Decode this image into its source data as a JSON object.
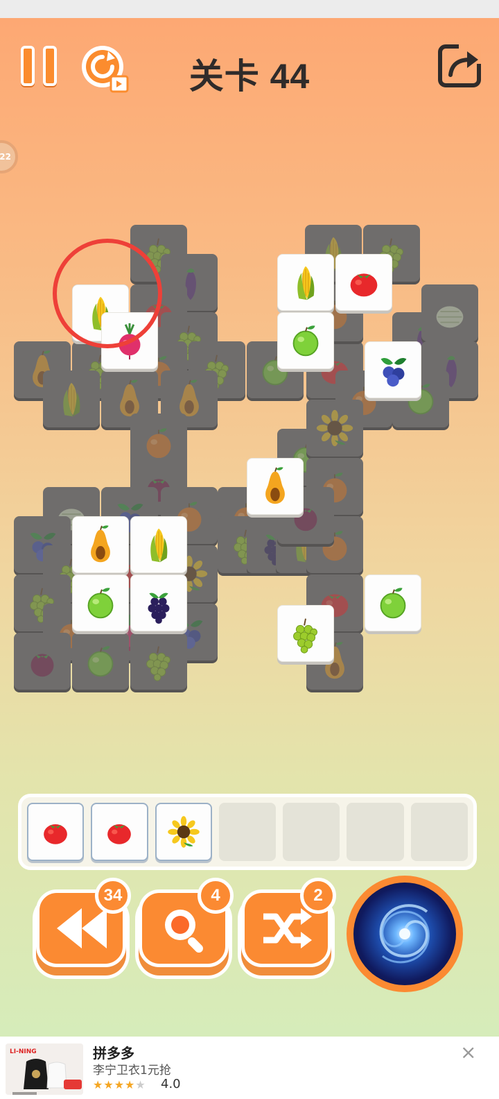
{
  "header": {
    "level_title": "关卡 44",
    "side_badge": "22"
  },
  "board": {
    "blocked_tiles": [
      "grapes",
      "eggplant",
      "corn",
      "tomato",
      "grapes",
      "pear",
      "grapes",
      "orange",
      "grapes",
      "pear",
      "pear",
      "orange",
      "lime",
      "tomato",
      "corn",
      "grapes",
      "orange",
      "eggplant",
      "melon",
      "eggplant",
      "orange",
      "lime",
      "orange",
      "mangosteen",
      "melon",
      "blueberry",
      "orange",
      "lime",
      "sunflower",
      "orange",
      "blueberry",
      "grapes",
      "tomato",
      "sunflower",
      "orange",
      "grapes",
      "blackberry",
      "corn",
      "orange",
      "grapes",
      "orange",
      "beet",
      "blueberry",
      "mangosteen",
      "lime",
      "grapes",
      "tomato",
      "pear",
      "mangosteen",
      "corn"
    ],
    "free_tiles": [
      "corn",
      "beet",
      "corn",
      "tomato",
      "lime",
      "blueberry",
      "pear",
      "pear",
      "corn",
      "lime",
      "blackberry",
      "grapes",
      "lime"
    ]
  },
  "tray": {
    "capacity": 7,
    "items": [
      "tomato",
      "tomato",
      "sunflower"
    ]
  },
  "tools": [
    {
      "name": "undo",
      "icon": "rewind-icon",
      "count": "34"
    },
    {
      "name": "hint",
      "icon": "magnifier-icon",
      "count": "4"
    },
    {
      "name": "shuffle",
      "icon": "shuffle-icon",
      "count": "2"
    }
  ],
  "ad": {
    "title": "拼多多",
    "subtitle": "李宁卫衣1元抢",
    "stars": "★★★★",
    "stars_empty": "★",
    "rating": "4.0",
    "close": "×"
  },
  "colors": {
    "accent_orange": "#fb8a32",
    "hint_red": "#ee4038"
  }
}
